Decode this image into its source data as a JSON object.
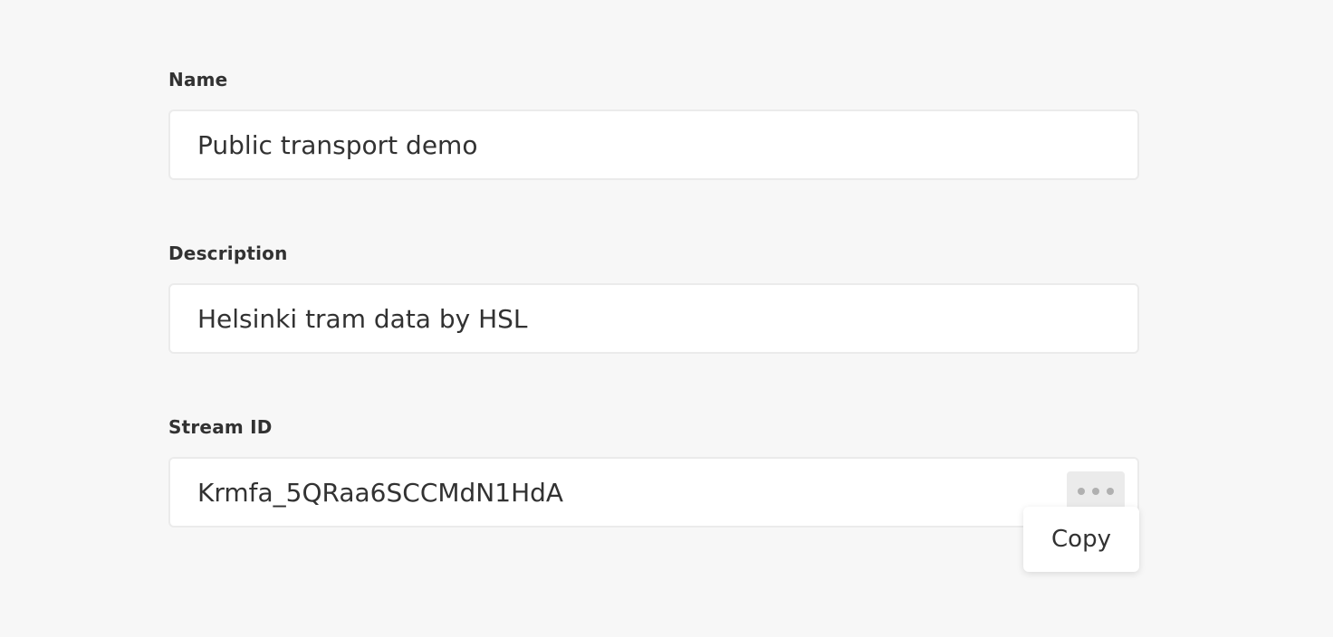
{
  "fields": {
    "name": {
      "label": "Name",
      "value": "Public transport demo"
    },
    "description": {
      "label": "Description",
      "value": "Helsinki tram data by HSL"
    },
    "stream_id": {
      "label": "Stream ID",
      "value": "Krmfa_5QRaa6SCCMdN1HdA"
    }
  },
  "menu": {
    "copy_label": "Copy"
  },
  "icons": {
    "more": "more-horizontal-icon"
  },
  "colors": {
    "background": "#f7f7f7",
    "input_background": "#ffffff",
    "input_border": "#ebebeb",
    "text": "#323232",
    "more_button_background": "#ebebeb",
    "more_dots": "#b0b0b0"
  }
}
